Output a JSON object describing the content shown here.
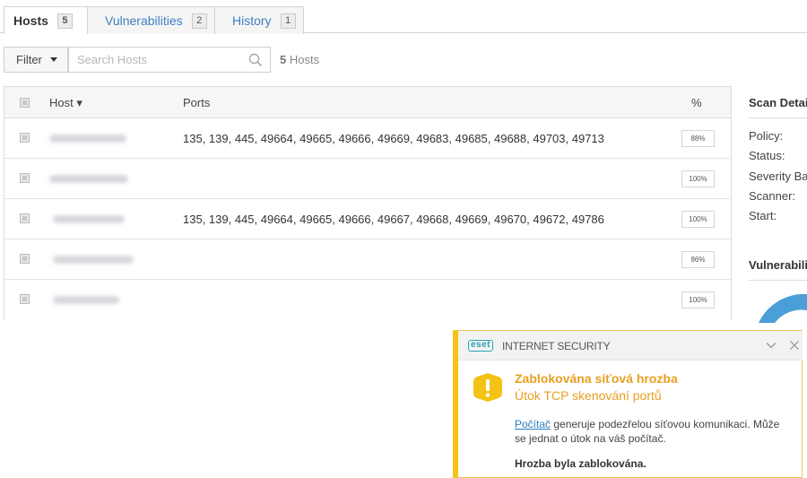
{
  "tabs": [
    {
      "label": "Hosts",
      "count": "5"
    },
    {
      "label": "Vulnerabilities",
      "count": "2"
    },
    {
      "label": "History",
      "count": "1"
    }
  ],
  "toolbar": {
    "filter_label": "Filter",
    "search_placeholder": "Search Hosts",
    "host_count_number": "5",
    "host_count_label": "Hosts"
  },
  "table": {
    "columns": {
      "host": "Host ▾",
      "ports": "Ports",
      "percent": "%"
    },
    "rows": [
      {
        "ports": "135, 139, 445, 49664, 49665, 49666, 49669, 49683, 49685, 49688, 49703, 49713",
        "percent": "88%"
      },
      {
        "ports": "",
        "percent": "100%"
      },
      {
        "ports": "135, 139, 445, 49664, 49665, 49666, 49667, 49668, 49669, 49670, 49672, 49786",
        "percent": "100%"
      },
      {
        "ports": "",
        "percent": "86%"
      },
      {
        "ports": "",
        "percent": "100%"
      }
    ]
  },
  "scan_details": {
    "title": "Scan Detai",
    "fields": [
      "Policy:",
      "Status:",
      "Severity Ba",
      "Scanner:",
      "Start:"
    ]
  },
  "vulnerabilities_title": "Vulnerabili",
  "eset": {
    "logo": "eset",
    "product": "INTERNET SECURITY",
    "title": "Zablokována síťová hrozba",
    "subtitle": "Útok TCP skenování portů",
    "body_link": "Počítač",
    "body_text": " generuje podezřelou síťovou komunikaci. Může se jednat o útok na váš počítač.",
    "blocked": "Hrozba byla zablokována.",
    "accent_color": "#f4c315"
  },
  "colors": {
    "link": "#3d7fc1",
    "warning": "#e8a020",
    "chart": "#4a9fd8"
  }
}
